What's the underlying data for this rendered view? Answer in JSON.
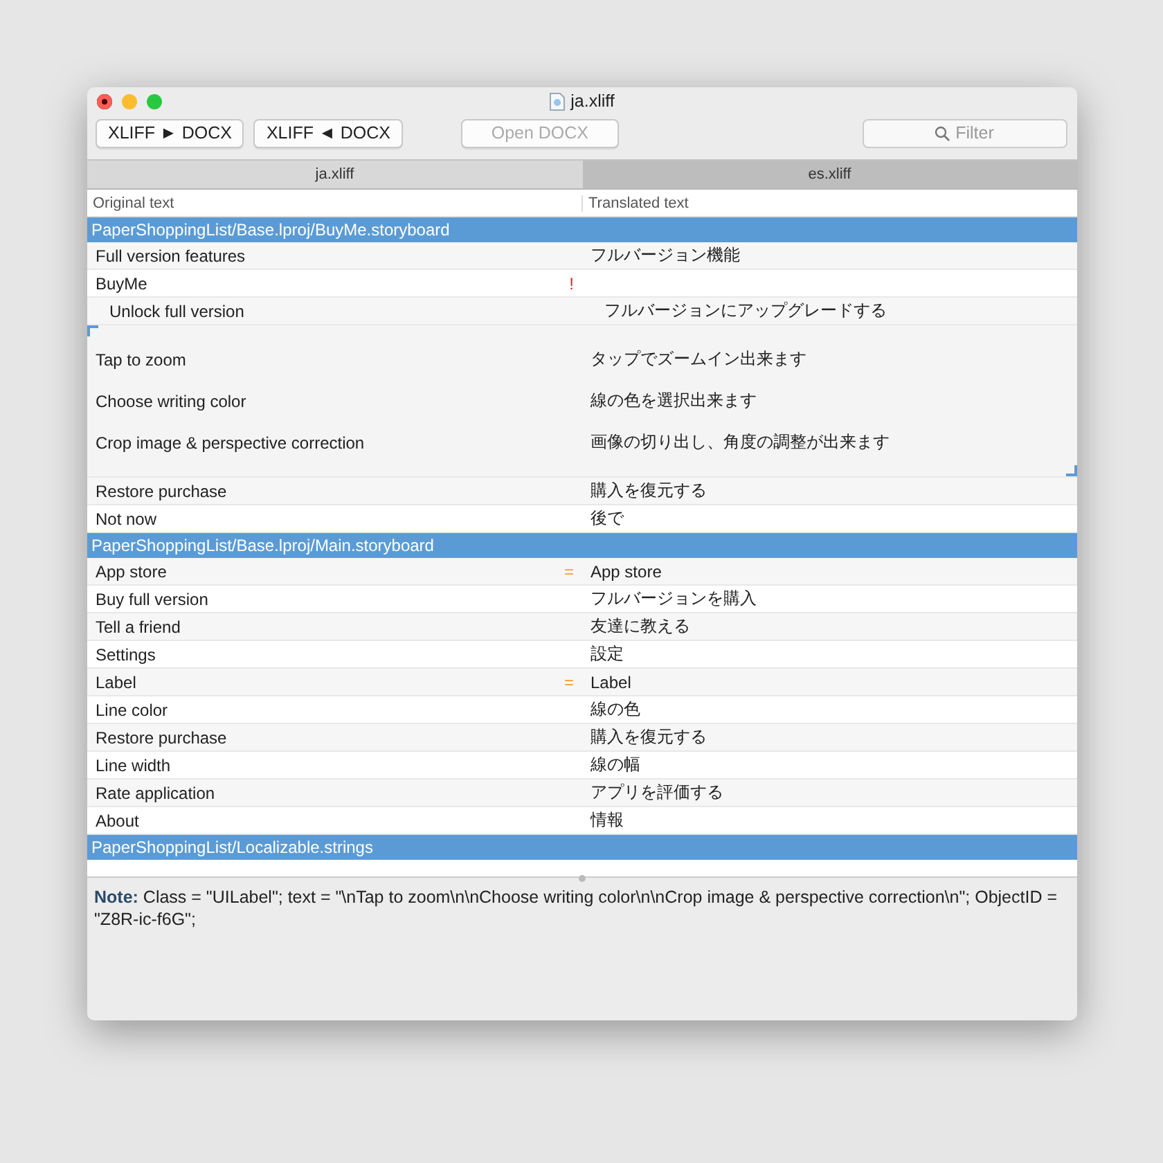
{
  "window": {
    "title": "ja.xliff"
  },
  "toolbar": {
    "buttons": [
      {
        "label": "XLIFF ► DOCX",
        "disabled": false
      },
      {
        "label": "XLIFF ◄ DOCX",
        "disabled": false
      },
      {
        "label": "Open DOCX",
        "disabled": true
      }
    ],
    "filter": {
      "placeholder": "Filter"
    }
  },
  "tabs": [
    {
      "label": "ja.xliff",
      "selected": true
    },
    {
      "label": "es.xliff",
      "selected": false
    }
  ],
  "table": {
    "columns": [
      "Original text",
      "Translated text"
    ],
    "groups": [
      {
        "title": "PaperShoppingList/Base.lproj/BuyMe.storyboard",
        "rows": [
          {
            "kind": "single",
            "source": "Full version features",
            "target": "フルバージョン機能",
            "selected": false
          },
          {
            "kind": "single",
            "source": "BuyMe",
            "target": "",
            "marker": "!",
            "selected": false,
            "children": [
              {
                "kind": "single",
                "source": "Unlock full version",
                "target": "フルバージョンにアップグレードする",
                "selected": false
              }
            ]
          },
          {
            "kind": "multiline",
            "lines": [
              {
                "source": "Tap to zoom",
                "target": "タップでズームイン出来ます"
              },
              {
                "source": "Choose writing color",
                "target": "線の色を選択出来ます"
              },
              {
                "source": "Crop image & perspective correction",
                "target": "画像の切り出し、角度の調整が出来ます"
              }
            ],
            "selected": true
          },
          {
            "kind": "single",
            "source": "Restore purchase",
            "target": "購入を復元する",
            "selected": false
          },
          {
            "kind": "single",
            "source": "Not now",
            "target": "後で",
            "selected": false
          }
        ]
      },
      {
        "title": "PaperShoppingList/Base.lproj/Main.storyboard",
        "rows": [
          {
            "kind": "single",
            "source": "App store",
            "target": "App store",
            "marker": "=",
            "selected": false
          },
          {
            "kind": "single",
            "source": "Buy full version",
            "target": "フルバージョンを購入",
            "selected": false
          },
          {
            "kind": "single",
            "source": "Tell a friend",
            "target": "友達に教える",
            "selected": false
          },
          {
            "kind": "single",
            "source": "Settings",
            "target": "設定",
            "selected": false
          },
          {
            "kind": "single",
            "source": "Label",
            "target": "Label",
            "marker": "=",
            "selected": false
          },
          {
            "kind": "single",
            "source": "Line color",
            "target": "線の色",
            "selected": false
          },
          {
            "kind": "single",
            "source": "Restore purchase",
            "target": "購入を復元する",
            "selected": false
          },
          {
            "kind": "single",
            "source": "Line width",
            "target": "線の幅",
            "selected": false
          },
          {
            "kind": "single",
            "source": "Rate application",
            "target": "アプリを評価する",
            "selected": false
          },
          {
            "kind": "single",
            "source": "About",
            "target": "情報",
            "selected": false
          }
        ]
      },
      {
        "title": "PaperShoppingList/Localizable.strings"
      }
    ]
  },
  "note": "**Note:** Class = \"UILabel\"; text = \"\\nTap to zoom\\n\\nChoose writing color\\n\\nCrop image & perspective correction\\n\"; ObjectID = \"Z8R-ic-f6G\";"
}
